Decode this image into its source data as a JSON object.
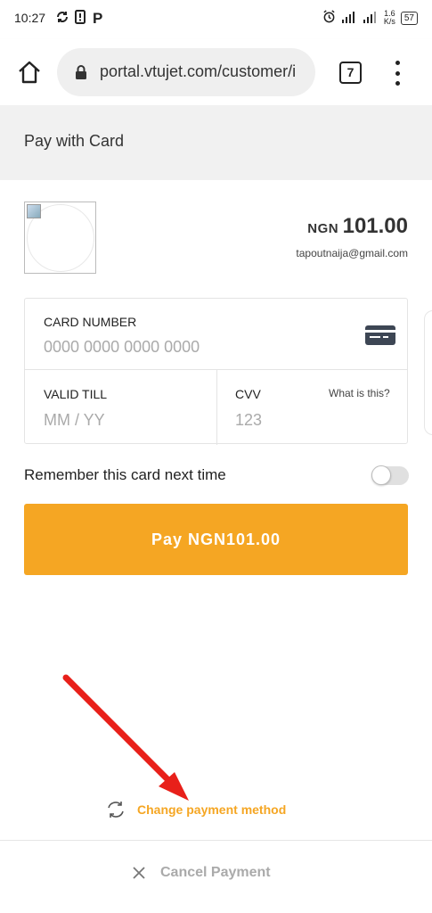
{
  "status_bar": {
    "time": "10:27",
    "icons": [
      "sync-icon",
      "sim-icon",
      "p-app-icon"
    ],
    "right_icons": [
      "alarm-icon",
      "signal-icon",
      "signal-icon"
    ],
    "speed": "1.6",
    "speed_unit": "K/s",
    "battery": "57"
  },
  "browser": {
    "url": "portal.vtujet.com/customer/i",
    "tab_count": "7"
  },
  "page": {
    "title": "Pay with Card"
  },
  "merchant": {
    "currency": "NGN",
    "amount": "101.00",
    "email": "tapoutnaija@gmail.com"
  },
  "card_form": {
    "card_number_label": "CARD NUMBER",
    "card_number_placeholder": "0000 0000 0000 0000",
    "valid_till_label": "VALID TILL",
    "valid_till_placeholder": "MM / YY",
    "cvv_label": "CVV",
    "cvv_placeholder": "123",
    "what_is_this": "What is this?"
  },
  "remember": {
    "label": "Remember this card next time",
    "enabled": false
  },
  "pay_button": {
    "label": "Pay NGN101.00"
  },
  "footer": {
    "change_payment": "Change payment method",
    "cancel_payment": "Cancel Payment"
  },
  "colors": {
    "accent": "#f5a623",
    "annotation_arrow": "#e8201a"
  }
}
